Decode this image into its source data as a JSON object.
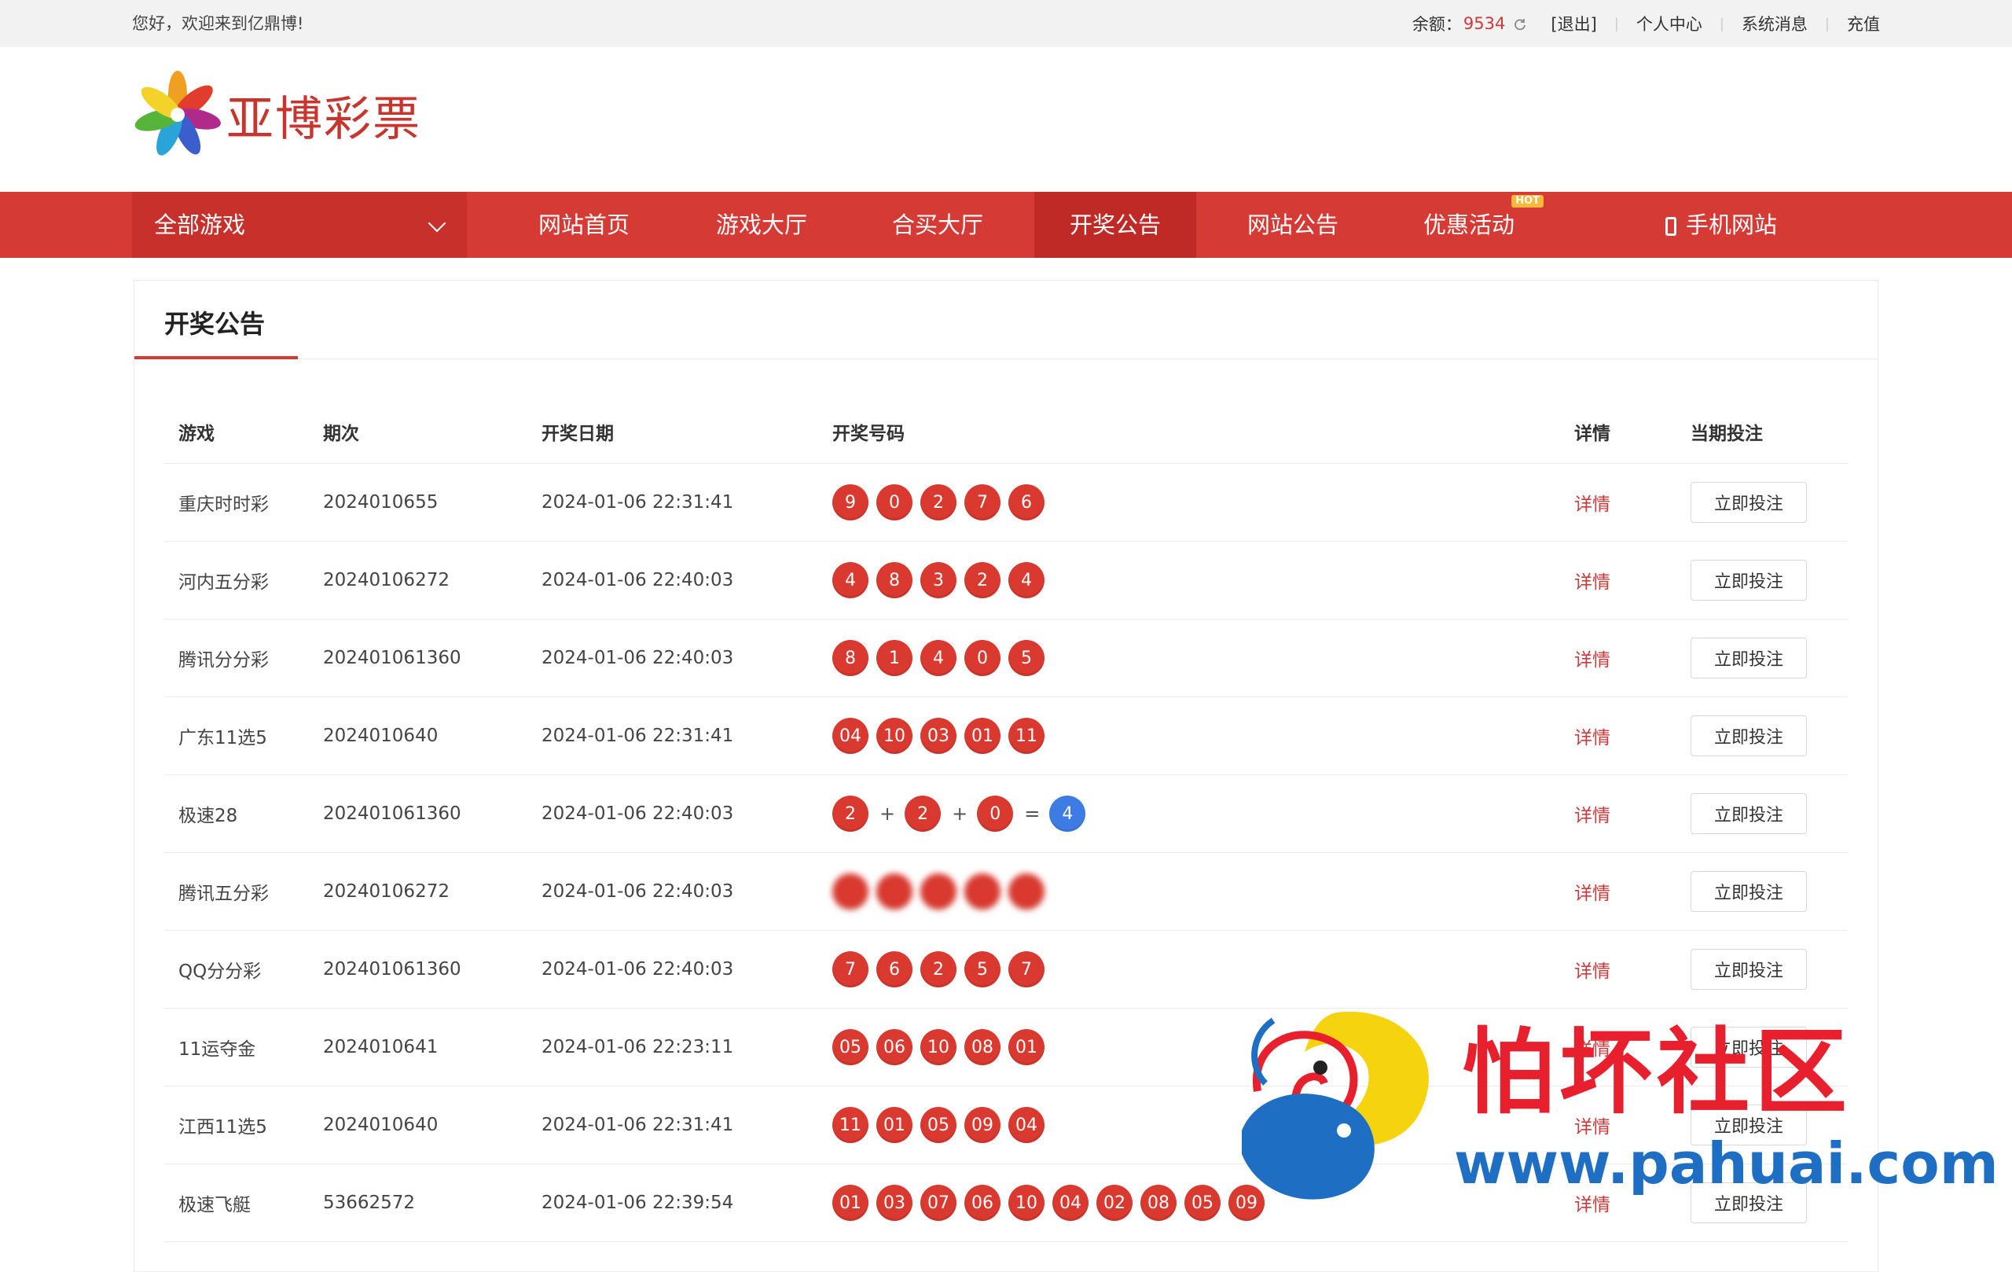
{
  "topbar": {
    "greeting": "您好，欢迎来到亿鼎博!",
    "balance_label": "余额：",
    "balance_value": "9534",
    "logout": "[退出]",
    "links": [
      "个人中心",
      "系统消息",
      "充值"
    ]
  },
  "logo": {
    "text": "亚博彩票"
  },
  "nav": {
    "all_games": "全部游戏",
    "items": [
      "网站首页",
      "游戏大厅",
      "合买大厅",
      "开奖公告",
      "网站公告",
      "优惠活动",
      "手机网站"
    ],
    "active": "开奖公告",
    "hot_badge": "HOT"
  },
  "panel": {
    "title": "开奖公告"
  },
  "table": {
    "headers": [
      "游戏",
      "期次",
      "开奖日期",
      "开奖号码",
      "详情",
      "当期投注"
    ],
    "detail_label": "详情",
    "bet_label": "立即投注",
    "rows": [
      {
        "game": "重庆时时彩",
        "issue": "2024010655",
        "date": "2024-01-06 22:31:41",
        "numbers": [
          "9",
          "0",
          "2",
          "7",
          "6"
        ]
      },
      {
        "game": "河内五分彩",
        "issue": "20240106272",
        "date": "2024-01-06 22:40:03",
        "numbers": [
          "4",
          "8",
          "3",
          "2",
          "4"
        ]
      },
      {
        "game": "腾讯分分彩",
        "issue": "202401061360",
        "date": "2024-01-06 22:40:03",
        "numbers": [
          "8",
          "1",
          "4",
          "0",
          "5"
        ]
      },
      {
        "game": "广东11选5",
        "issue": "2024010640",
        "date": "2024-01-06 22:31:41",
        "numbers": [
          "04",
          "10",
          "03",
          "01",
          "11"
        ]
      },
      {
        "game": "极速28",
        "issue": "202401061360",
        "date": "2024-01-06 22:40:03",
        "numbers": [
          "2",
          "2",
          "0"
        ],
        "sum": "4"
      },
      {
        "game": "腾讯五分彩",
        "issue": "20240106272",
        "date": "2024-01-06 22:40:03",
        "numbers": [
          "",
          "",
          "",
          "",
          ""
        ],
        "blurred": true
      },
      {
        "game": "QQ分分彩",
        "issue": "202401061360",
        "date": "2024-01-06 22:40:03",
        "numbers": [
          "7",
          "6",
          "2",
          "5",
          "7"
        ]
      },
      {
        "game": "11运夺金",
        "issue": "2024010641",
        "date": "2024-01-06 22:23:11",
        "numbers": [
          "05",
          "06",
          "10",
          "08",
          "01"
        ]
      },
      {
        "game": "江西11选5",
        "issue": "2024010640",
        "date": "2024-01-06 22:31:41",
        "numbers": [
          "11",
          "01",
          "05",
          "09",
          "04"
        ]
      },
      {
        "game": "极速飞艇",
        "issue": "53662572",
        "date": "2024-01-06 22:39:54",
        "numbers": [
          "01",
          "03",
          "07",
          "06",
          "10",
          "04",
          "02",
          "08",
          "05",
          "09"
        ]
      }
    ]
  },
  "watermark": {
    "text": "怕坏社区",
    "url": "www.pahuai.com"
  }
}
